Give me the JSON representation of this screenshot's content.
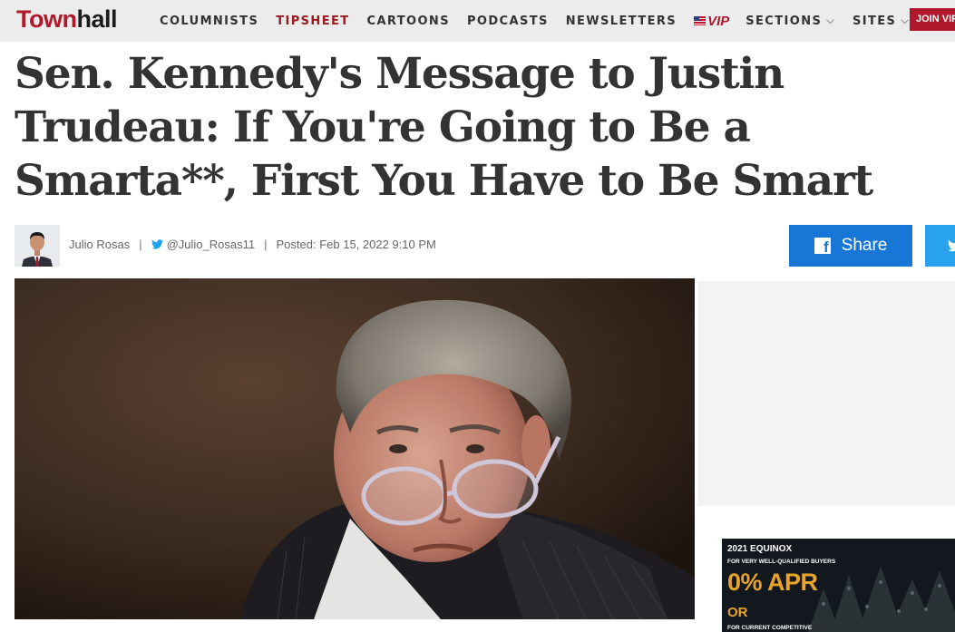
{
  "brand": {
    "town": "Town",
    "hall": "hall"
  },
  "nav": {
    "columnists": "COLUMNISTS",
    "tipsheet": "TIPSHEET",
    "cartoons": "CARTOONS",
    "podcasts": "PODCASTS",
    "newsletters": "NEWSLETTERS",
    "vip": "VIP",
    "sections": "SECTIONS",
    "sites": "SITES",
    "join": "JOIN VIP"
  },
  "article": {
    "headline": "Sen. Kennedy's Message to Justin Trudeau: If You're Going to Be a Smarta**, First You Have to Be Smart",
    "author": "Julio Rosas",
    "twitter_handle": "@Julio_Rosas11",
    "posted": "Posted: Feb 15, 2022 9:10 PM",
    "separator": "|"
  },
  "share": {
    "facebook_label": "Share"
  },
  "ad": {
    "line1": "2021 EQUINOX",
    "line2": "FOR VERY WELL-QUALIFIED BUYERS",
    "line3": "0% APR",
    "line4": "OR",
    "line5": "FOR CURRENT COMPETITIVE"
  },
  "colors": {
    "brand_red": "#b0182b",
    "facebook_blue": "#1877d6",
    "twitter_blue": "#2aa3ef",
    "nav_bg": "#ececec"
  }
}
